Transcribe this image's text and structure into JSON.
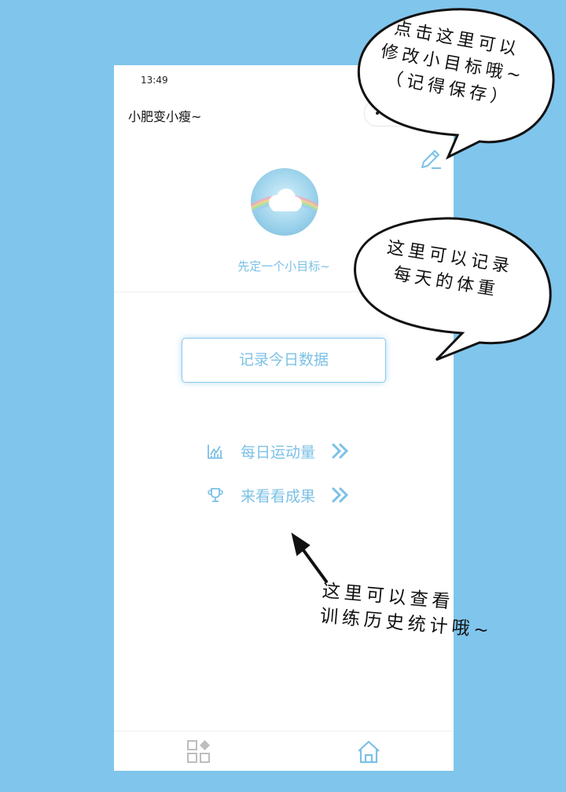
{
  "status_bar": {
    "time": "13:49"
  },
  "header": {
    "title": "小肥变小瘦~"
  },
  "profile": {
    "goal_text": "先定一个小目标~"
  },
  "record_button": {
    "label": "记录今日数据"
  },
  "menu": [
    {
      "label": "每日运动量",
      "icon": "bar-chart-icon"
    },
    {
      "label": "来看看成果",
      "icon": "trophy-icon"
    }
  ],
  "annotations": {
    "edit_goal": [
      "点击这里可以",
      "修改小目标哦~",
      "（记得保存）"
    ],
    "record_weight": [
      "这里可以记录",
      "每天的体重"
    ],
    "history": [
      "这里可以查看",
      "训练历史统计哦~"
    ]
  },
  "colors": {
    "background": "#80c5ec",
    "accent": "#7cc1e6"
  }
}
